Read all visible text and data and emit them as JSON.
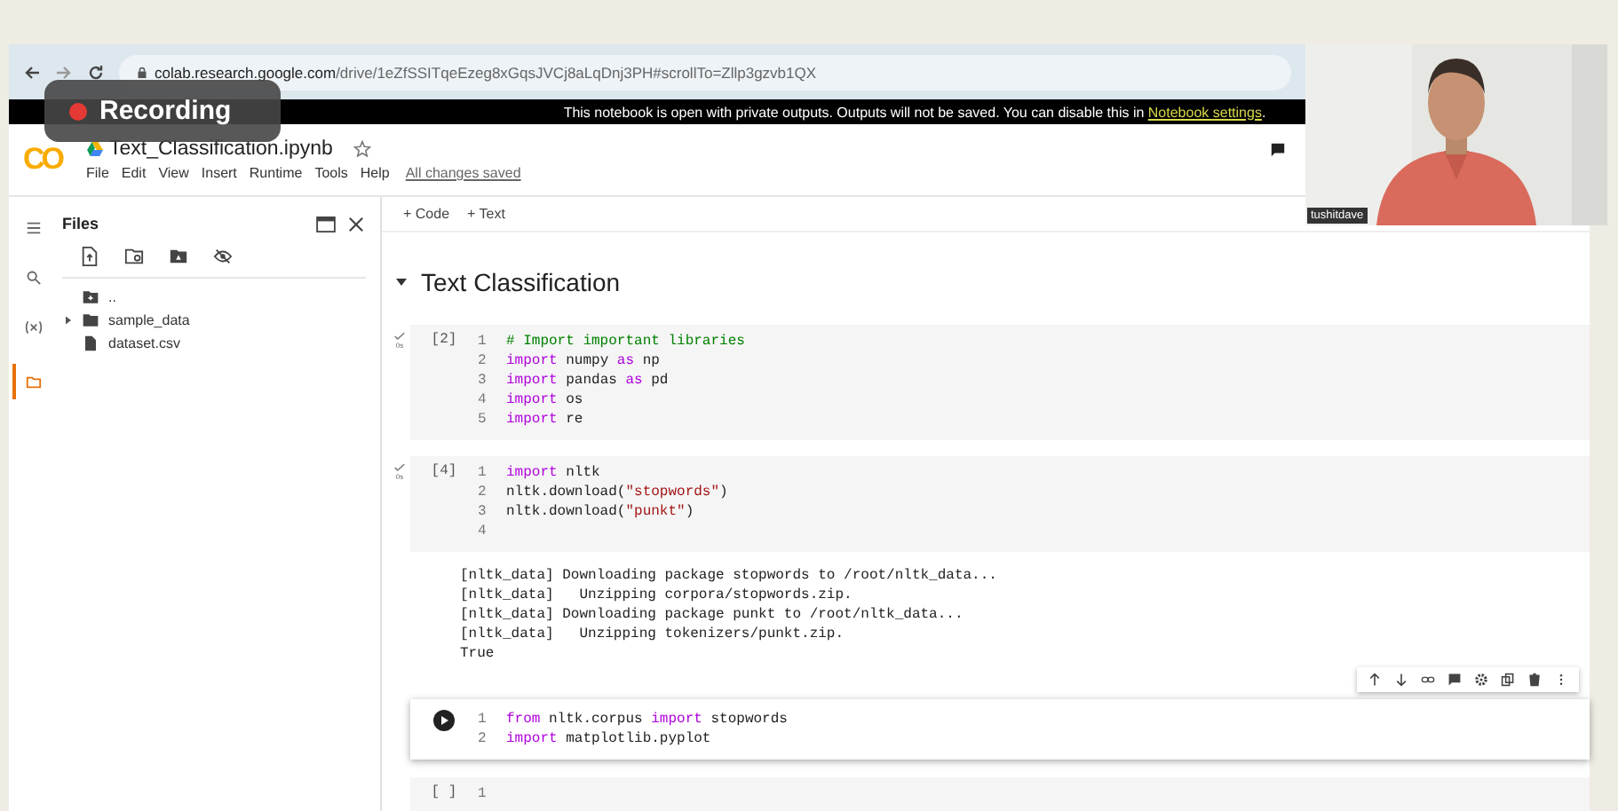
{
  "browser": {
    "url_host": "colab.research.google.com",
    "url_path": "/drive/1eZfSSITqeEzeg8xGqsJVCj8aLqDnj3PH#scrollTo=Zllp3gzvb1QX"
  },
  "recording": {
    "label": "Recording"
  },
  "banner": {
    "text": "This notebook is open with private outputs. Outputs will not be saved. You can disable this in ",
    "link": "Notebook settings",
    "end": "."
  },
  "notebook": {
    "logo": "CO",
    "title": "Text_Classification.ipynb",
    "menu": [
      "File",
      "Edit",
      "View",
      "Insert",
      "Runtime",
      "Tools",
      "Help"
    ],
    "save_status": "All changes saved"
  },
  "rail": [
    {
      "kind": "toc",
      "selected": false
    },
    {
      "kind": "search",
      "selected": false
    },
    {
      "kind": "variables",
      "selected": false
    },
    {
      "kind": "files",
      "selected": true
    }
  ],
  "sidebar": {
    "title": "Files",
    "files": [
      {
        "name": "..",
        "kind": "parent"
      },
      {
        "name": "sample_data",
        "kind": "folder"
      },
      {
        "name": "dataset.csv",
        "kind": "file"
      }
    ]
  },
  "toolbar": [
    "+ Code",
    "+ Text"
  ],
  "section": {
    "title": "Text Classification"
  },
  "cells": [
    {
      "kind": "done",
      "count": "[2]",
      "time": "0s",
      "lines": [
        {
          "num": "1",
          "tokens": [
            {
              "kind": "comment",
              "text": "# Import important libraries"
            }
          ]
        },
        {
          "num": "2",
          "tokens": [
            {
              "kind": "kw",
              "text": "import"
            },
            {
              "kind": "plain",
              "text": " numpy "
            },
            {
              "kind": "kw",
              "text": "as"
            },
            {
              "kind": "plain",
              "text": " np"
            }
          ]
        },
        {
          "num": "3",
          "tokens": [
            {
              "kind": "kw",
              "text": "import"
            },
            {
              "kind": "plain",
              "text": " pandas "
            },
            {
              "kind": "kw",
              "text": "as"
            },
            {
              "kind": "plain",
              "text": " pd"
            }
          ]
        },
        {
          "num": "4",
          "tokens": [
            {
              "kind": "kw",
              "text": "import"
            },
            {
              "kind": "plain",
              "text": " os"
            }
          ]
        },
        {
          "num": "5",
          "tokens": [
            {
              "kind": "kw",
              "text": "import"
            },
            {
              "kind": "plain",
              "text": " re"
            }
          ]
        }
      ]
    },
    {
      "kind": "done",
      "count": "[4]",
      "time": "0s",
      "lines": [
        {
          "num": "1",
          "tokens": [
            {
              "kind": "kw",
              "text": "import"
            },
            {
              "kind": "plain",
              "text": " nltk"
            }
          ]
        },
        {
          "num": "2",
          "tokens": [
            {
              "kind": "plain",
              "text": "nltk.download("
            },
            {
              "kind": "str",
              "text": "\"stopwords\""
            },
            {
              "kind": "plain",
              "text": ")"
            }
          ]
        },
        {
          "num": "3",
          "tokens": [
            {
              "kind": "plain",
              "text": "nltk.download("
            },
            {
              "kind": "str",
              "text": "\"punkt\""
            },
            {
              "kind": "plain",
              "text": ")"
            }
          ]
        },
        {
          "num": "4"
        }
      ],
      "output": [
        "[nltk_data] Downloading package stopwords to /root/nltk_data...",
        "[nltk_data]   Unzipping corpora/stopwords.zip.",
        "[nltk_data] Downloading package punkt to /root/nltk_data...",
        "[nltk_data]   Unzipping tokenizers/punkt.zip.",
        "True"
      ]
    },
    {
      "kind": "active",
      "lines": [
        {
          "num": "1",
          "tokens": [
            {
              "kind": "kw",
              "text": "from"
            },
            {
              "kind": "plain",
              "text": " nltk.corpus "
            },
            {
              "kind": "kw",
              "text": "import"
            },
            {
              "kind": "plain",
              "text": " stopwords"
            }
          ]
        },
        {
          "num": "2",
          "tokens": [
            {
              "kind": "kw",
              "text": "import"
            },
            {
              "kind": "plain",
              "text": " matplotlib.pyplot"
            }
          ]
        }
      ]
    },
    {
      "kind": "empty",
      "count": "[ ]",
      "lines": [
        {
          "num": "1"
        }
      ]
    }
  ],
  "webcam": {
    "kind": "picture",
    "name": "tushitdave"
  }
}
